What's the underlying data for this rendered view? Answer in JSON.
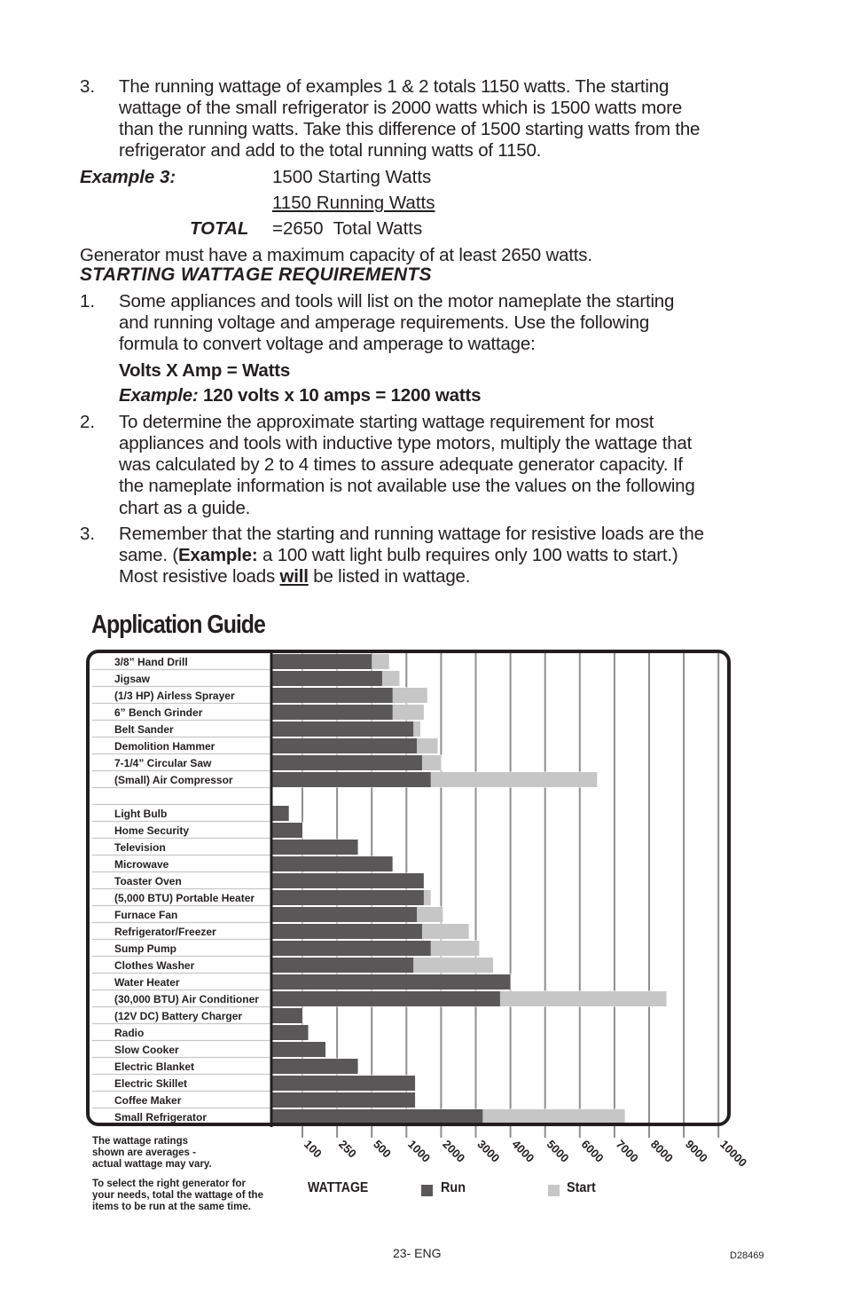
{
  "intro": {
    "item3_number": "3.",
    "item3_lines": [
      "The running wattage of examples 1 & 2 totals 1150 watts. The starting",
      "wattage of the small refrigerator is 2000 watts which is 1500 watts more",
      "than the running watts. Take this difference of 1500 starting watts from the",
      "refrigerator and add to the total running watts of 1150."
    ],
    "example3_label": "Example 3:",
    "example3_line1": "1500 Starting Watts",
    "example3_line2": "1150 Running Watts",
    "total_label": "TOTAL",
    "total_value": "=2650  Total Watts",
    "capacity_note": "Generator must have a maximum capacity of at least 2650 watts."
  },
  "section": {
    "heading": "STARTING WATTAGE REQUIREMENTS",
    "item1_number": "1.",
    "item1_lines": [
      "Some appliances and tools will list on the motor nameplate the starting",
      "and running voltage and amperage requirements. Use the following",
      "formula to convert voltage and amperage to wattage:"
    ],
    "formula": "Volts X Amp = Watts",
    "formula_example_label": "Example:",
    "formula_example_text": " 120 volts x 10 amps = 1200 watts",
    "item2_number": "2.",
    "item2_lines": [
      "To determine the approximate starting wattage requirement for most",
      "appliances and tools with inductive type motors, multiply the wattage that",
      "was calculated by 2 to 4 times to assure adequate generator capacity. If",
      "the nameplate information is not available use the values on the following",
      "chart as a guide."
    ],
    "item3_number": "3.",
    "item3_line1": "Remember that the starting and running wattage for resistive loads are the",
    "item3_line2_pre": "same. (",
    "item3_line2_bold": "Example:",
    "item3_line2_post": " a 100 watt light bulb requires only 100 watts to start.)",
    "item3_line3_pre": "Most resistive loads ",
    "item3_line3_em": "will",
    "item3_line3_post": " be listed in wattage."
  },
  "guide": {
    "title": "Application Guide",
    "note1_lines": [
      "The wattage ratings",
      "shown are averages -",
      "actual wattage may vary."
    ],
    "note2_lines": [
      "To select the right generator for",
      "your needs, total the wattage of the",
      "items to be run at the same time."
    ],
    "legend_title": "WATTAGE",
    "legend_run": "Run",
    "legend_start": "Start"
  },
  "colors": {
    "run": "#5a5758",
    "start": "#c6c6c6",
    "frame": "#231f20",
    "grid": "#8e8e8e",
    "row_line": "#c8c8c8"
  },
  "chart_data": {
    "type": "bar",
    "orientation": "horizontal",
    "stacked": true,
    "title": "Application Guide",
    "xlabel": "WATTAGE",
    "x_ticks": [
      100,
      250,
      500,
      1000,
      2000,
      3000,
      4000,
      5000,
      6000,
      7000,
      8000,
      9000,
      10000
    ],
    "x_tick_labels": [
      "100",
      "250",
      "500",
      "1000",
      "2000",
      "3000",
      "4000",
      "5000",
      "6000",
      "7000",
      "8000",
      "9000",
      "10000"
    ],
    "xlim": [
      0,
      10000
    ],
    "grid": true,
    "legend": "bottom",
    "series_names": [
      "Run",
      "Start"
    ],
    "groups": [
      {
        "items": [
          {
            "label": "3/8” Hand Drill",
            "run": 500,
            "start": 750
          },
          {
            "label": "Jigsaw",
            "run": 650,
            "start": 900
          },
          {
            "label": "(1/3 HP) Airless Sprayer",
            "run": 800,
            "start": 1600
          },
          {
            "label": "6” Bench Grinder",
            "run": 800,
            "start": 1500
          },
          {
            "label": "Belt Sander",
            "run": 1200,
            "start": 1400
          },
          {
            "label": "Demolition Hammer",
            "run": 1300,
            "start": 1900
          },
          {
            "label": "7-1/4” Circular Saw",
            "run": 1450,
            "start": 2000
          },
          {
            "label": "(Small) Air Compressor",
            "run": 1700,
            "start": 6500
          }
        ]
      },
      {
        "items": [
          {
            "label": "Light Bulb",
            "run": 55,
            "start": 55
          },
          {
            "label": "Home Security",
            "run": 100,
            "start": 100
          },
          {
            "label": "Television",
            "run": 400,
            "start": 400
          },
          {
            "label": "Microwave",
            "run": 800,
            "start": 800
          },
          {
            "label": "Toaster Oven",
            "run": 1500,
            "start": 1500
          },
          {
            "label": "(5,000 BTU) Portable Heater",
            "run": 1500,
            "start": 1700
          },
          {
            "label": "Furnace Fan",
            "run": 1300,
            "start": 2050
          },
          {
            "label": "Refrigerator/Freezer",
            "run": 1450,
            "start": 2800
          },
          {
            "label": "Sump Pump",
            "run": 1700,
            "start": 3100
          },
          {
            "label": "Clothes Washer",
            "run": 1200,
            "start": 3500
          },
          {
            "label": "Water Heater",
            "run": 4000,
            "start": 4000
          },
          {
            "label": "(30,000 BTU) Air Conditioner",
            "run": 3700,
            "start": 8500
          },
          {
            "label": "(12V DC) Battery Charger",
            "run": 100,
            "start": 100
          },
          {
            "label": "Radio",
            "run": 125,
            "start": 125
          },
          {
            "label": "Slow Cooker",
            "run": 200,
            "start": 200
          },
          {
            "label": "Electric Blanket",
            "run": 400,
            "start": 400
          },
          {
            "label": "Electric Skillet",
            "run": 1250,
            "start": 1250
          },
          {
            "label": "Coffee Maker",
            "run": 1250,
            "start": 1250
          },
          {
            "label": "Small Refrigerator",
            "run": 3200,
            "start": 7300
          }
        ]
      }
    ]
  },
  "footer": {
    "page": "23- ENG",
    "code": "D28469"
  }
}
